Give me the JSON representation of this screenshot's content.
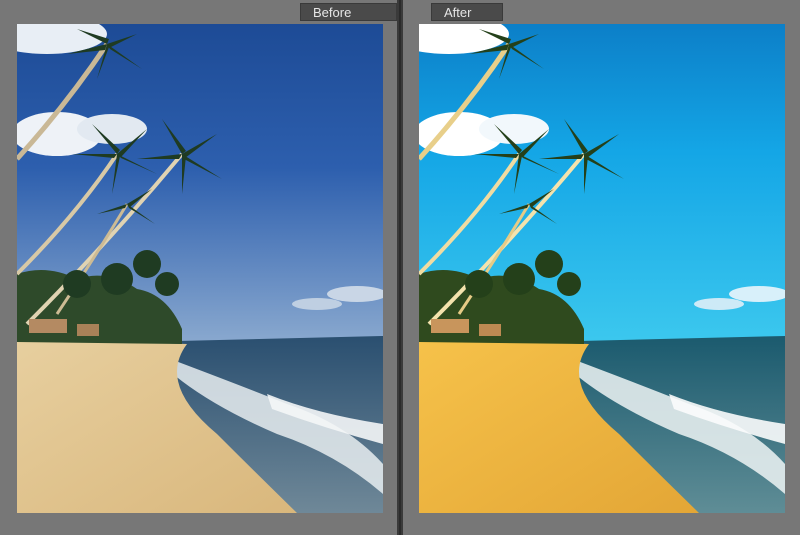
{
  "compare": {
    "before_label": "Before",
    "after_label": "After"
  },
  "icons": {
    "scene": "beach-palm-photo"
  },
  "colors": {
    "background": "#777777",
    "divider": "#3a3a3a",
    "tab_bg": "#4a4a4a",
    "tab_text": "#e6e6e6"
  }
}
